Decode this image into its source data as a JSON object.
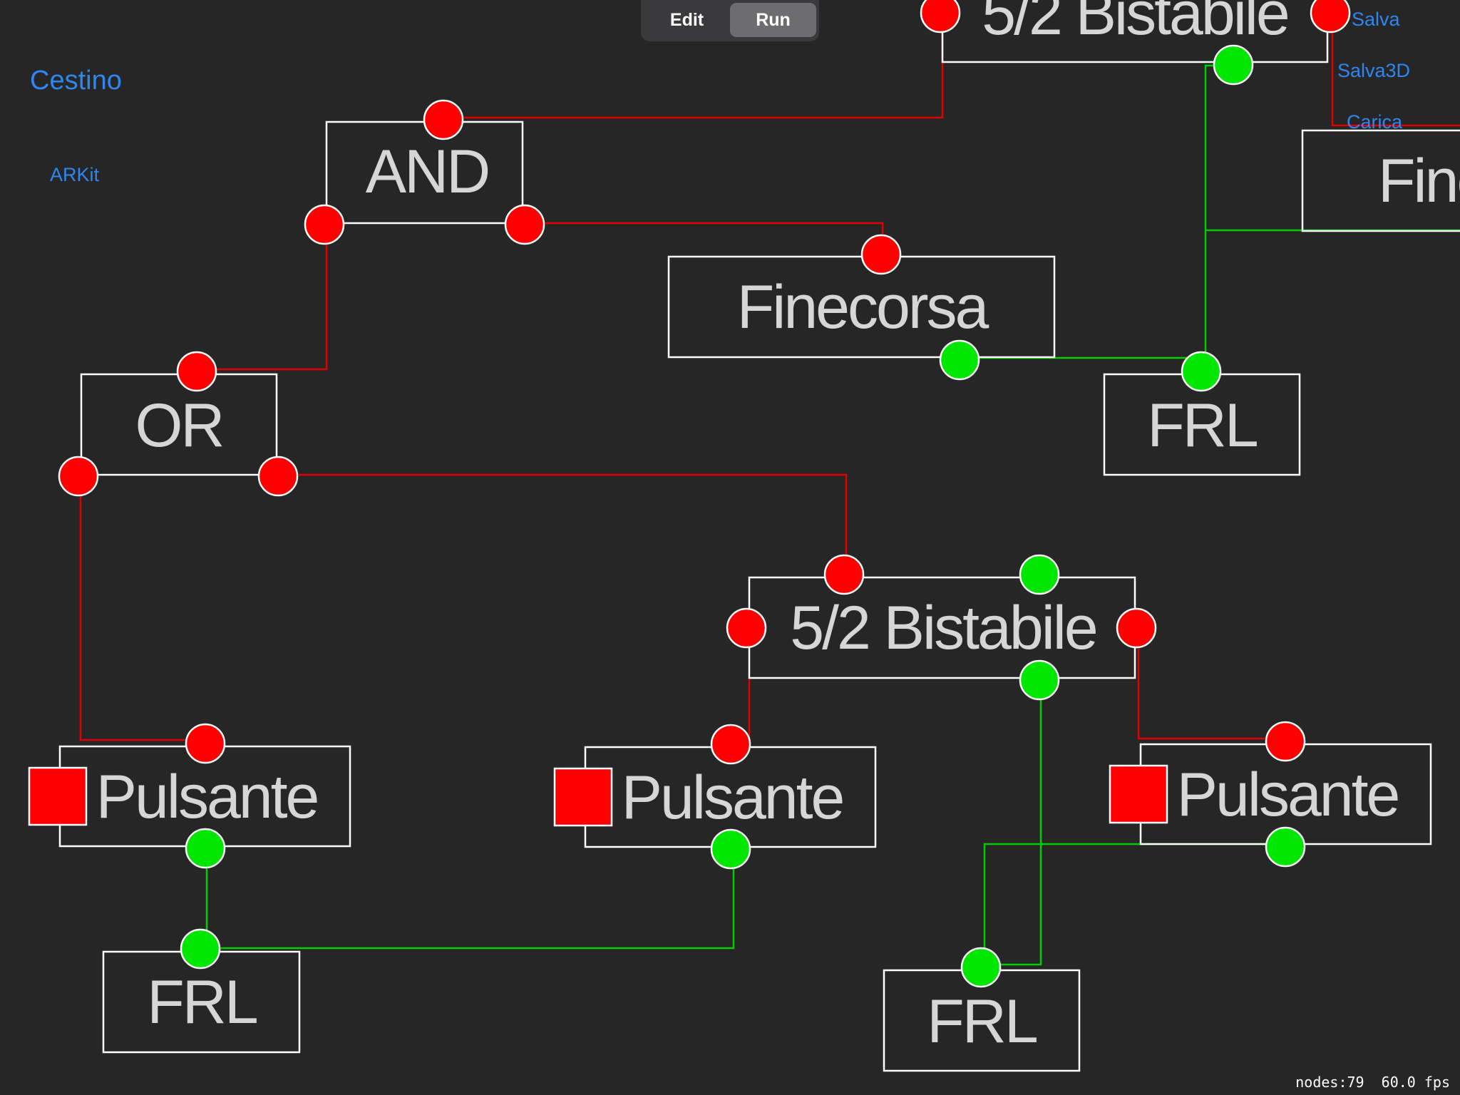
{
  "mode_control": {
    "edit_label": "Edit",
    "run_label": "Run",
    "selected": "Run"
  },
  "actions": {
    "cestino": "Cestino",
    "arkit": "ARKit",
    "salva": "Salva",
    "salva3d": "Salva3D",
    "carica": "Carica"
  },
  "stats": {
    "nodes_label": "nodes:79",
    "fps_label": "60.0 fps"
  },
  "colors": {
    "background": "#262626",
    "port_off": "#ff0000",
    "port_on": "#00e600",
    "wire_off": "#e00000",
    "wire_on": "#00cc00",
    "link": "#2f86f0"
  },
  "nodes": {
    "bistabile_top": {
      "label": "5/2 Bistabile",
      "type": "valve-5-2-bistable"
    },
    "and_gate": {
      "label": "AND",
      "type": "logic-and"
    },
    "finecorsa_center": {
      "label": "Finecorsa",
      "type": "limit-switch"
    },
    "finecorsa_right": {
      "label": "Finecorsa",
      "type": "limit-switch"
    },
    "or_gate": {
      "label": "OR",
      "type": "logic-or"
    },
    "frl_top_right": {
      "label": "FRL",
      "type": "air-supply-unit"
    },
    "bistabile_middle": {
      "label": "5/2 Bistabile",
      "type": "valve-5-2-bistable"
    },
    "pulsante_left": {
      "label": "Pulsante",
      "type": "push-button",
      "button_color": "#ff0000"
    },
    "pulsante_center": {
      "label": "Pulsante",
      "type": "push-button",
      "button_color": "#ff0000"
    },
    "pulsante_right": {
      "label": "Pulsante",
      "type": "push-button",
      "button_color": "#ff0000"
    },
    "frl_bottom_left": {
      "label": "FRL",
      "type": "air-supply-unit"
    },
    "frl_bottom_center": {
      "label": "FRL",
      "type": "air-supply-unit"
    }
  }
}
